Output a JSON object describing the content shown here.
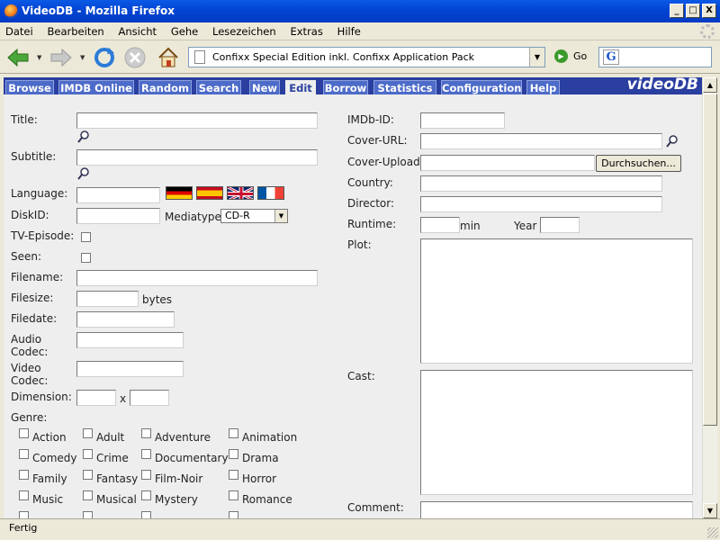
{
  "window": {
    "title": "VideoDB - Mozilla Firefox",
    "minimize": "_",
    "maximize": "□",
    "close": "X"
  },
  "menu": [
    "Datei",
    "Bearbeiten",
    "Ansicht",
    "Gehe",
    "Lesezeichen",
    "Extras",
    "Hilfe"
  ],
  "navbar": {
    "url": "Confixx Special Edition inkl. Confixx Application Pack",
    "go_label": "Go"
  },
  "tabs": [
    "Browse",
    "IMDB Online",
    "Random",
    "Search",
    "New",
    "Edit",
    "Borrow",
    "Statistics",
    "Configuration",
    "Help"
  ],
  "active_tab": "Edit",
  "brand": "videoDB",
  "form": {
    "title": "Title:",
    "subtitle": "Subtitle:",
    "language": "Language:",
    "diskid": "DiskID:",
    "mediatype": "Mediatype",
    "mediatype_value": "CD-R",
    "tv_episode": "TV-Episode:",
    "seen": "Seen:",
    "filename": "Filename:",
    "filesize": "Filesize:",
    "bytes": "bytes",
    "filedate": "Filedate:",
    "audio_codec_1": "Audio",
    "audio_codec_2": "Codec:",
    "video_codec_1": "Video",
    "video_codec_2": "Codec:",
    "dimension": "Dimension:",
    "x": "x",
    "genre": "Genre:",
    "imdb_id": "IMDb-ID:",
    "cover_url": "Cover-URL:",
    "cover_upload": "Cover-Upload:",
    "browse_button": "Durchsuchen...",
    "country": "Country:",
    "director": "Director:",
    "runtime": "Runtime:",
    "min": "min",
    "year": "Year",
    "plot": "Plot:",
    "cast": "Cast:",
    "comment": "Comment:"
  },
  "genres": [
    "Action",
    "Adult",
    "Adventure",
    "Animation",
    "Comedy",
    "Crime",
    "Documentary",
    "Drama",
    "Family",
    "Fantasy",
    "Film-Noir",
    "Horror",
    "Music",
    "Musical",
    "Mystery",
    "Romance"
  ],
  "flags": [
    "german-flag",
    "spanish-flag",
    "uk-flag",
    "french-flag"
  ],
  "status": "Fertig",
  "colors": {
    "tab_bar": "#2a3fa0",
    "tab": "#4d6bc8",
    "xp_title": "#0346d4",
    "content_bg": "#eeeeee"
  }
}
